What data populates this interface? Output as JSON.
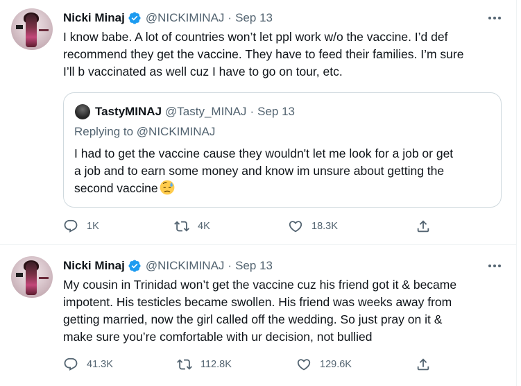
{
  "tweets": [
    {
      "author": {
        "name": "Nicki Minaj",
        "handle": "@NICKIMINAJ",
        "verified": true
      },
      "separator": "·",
      "date": "Sep 13",
      "lines": [
        "I know babe. A lot of countries won’t let ppl work w/o the vaccine. I’d def",
        "recommend they get the vaccine. They have to feed their families. I’m sure",
        "I’ll b vaccinated as well cuz I have to go on tour, etc."
      ],
      "quoted": {
        "author": {
          "name": "TastyMINAJ",
          "handle": "@Tasty_MINAJ"
        },
        "separator": "·",
        "date": "Sep 13",
        "replying_to_prefix": "Replying to ",
        "replying_to_handle": "@NICKIMINAJ",
        "lines": [
          "I had to get the vaccine cause they wouldn't let me look for a job or get",
          "a job and to earn some money and know im unsure about getting the",
          "second vaccine"
        ],
        "emoji": "downcast-face-with-sweat"
      },
      "metrics": {
        "replies": "1K",
        "retweets": "4K",
        "likes": "18.3K"
      }
    },
    {
      "author": {
        "name": "Nicki Minaj",
        "handle": "@NICKIMINAJ",
        "verified": true
      },
      "separator": "·",
      "date": "Sep 13",
      "lines": [
        "My cousin in Trinidad won’t get the vaccine cuz his friend got it & became",
        "impotent. His testicles became swollen. His friend was weeks away from",
        "getting married, now the girl called off the wedding. So just pray on it &",
        "make sure you’re comfortable with ur decision, not bullied"
      ],
      "metrics": {
        "replies": "41.3K",
        "retweets": "112.8K",
        "likes": "129.6K"
      }
    }
  ],
  "icons": {
    "verified": "verified-badge-icon",
    "more": "more-options-icon",
    "reply": "reply-icon",
    "retweet": "retweet-icon",
    "like": "heart-icon",
    "share": "share-icon"
  },
  "colors": {
    "text_primary": "#0f1419",
    "text_secondary": "#536471",
    "verified_blue": "#1d9bf0",
    "border": "#cfd9de",
    "divider": "#eff3f4"
  }
}
